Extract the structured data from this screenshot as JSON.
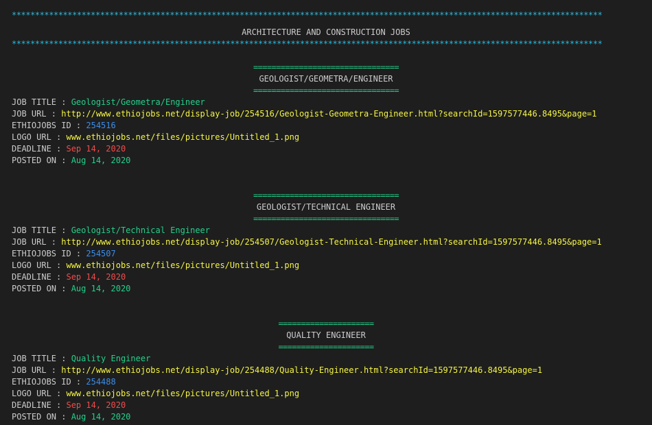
{
  "header": {
    "stars": "*******************************************************************************************************************************",
    "title": "ARCHITECTURE AND CONSTRUCTION JOBS"
  },
  "labels": {
    "job_title": "JOB TITLE : ",
    "job_url": "JOB URL : ",
    "ethiojobs_id": "ETHIOJOBS ID : ",
    "logo_url": "LOGO URL : ",
    "deadline": "DEADLINE : ",
    "posted_on": "POSTED ON : "
  },
  "jobs": [
    {
      "rule": "================================",
      "heading": "GEOLOGIST/GEOMETRA/ENGINEER",
      "job_title": "Geologist/Geometra/Engineer",
      "job_url": "http://www.ethiojobs.net/display-job/254516/Geologist-Geometra-Engineer.html?searchId=1597577446.8495&page=1",
      "ethiojobs_id": "254516",
      "logo_url": "www.ethiojobs.net/files/pictures/Untitled_1.png",
      "deadline": "Sep 14, 2020",
      "posted_on": "Aug 14, 2020"
    },
    {
      "rule": "================================",
      "heading": "GEOLOGIST/TECHNICAL ENGINEER",
      "job_title": "Geologist/Technical Engineer",
      "job_url": "http://www.ethiojobs.net/display-job/254507/Geologist-Technical-Engineer.html?searchId=1597577446.8495&page=1",
      "ethiojobs_id": "254507",
      "logo_url": "www.ethiojobs.net/files/pictures/Untitled_1.png",
      "deadline": "Sep 14, 2020",
      "posted_on": "Aug 14, 2020"
    },
    {
      "rule": "=====================",
      "heading": "QUALITY ENGINEER",
      "job_title": "Quality Engineer",
      "job_url": "http://www.ethiojobs.net/display-job/254488/Quality-Engineer.html?searchId=1597577446.8495&page=1",
      "ethiojobs_id": "254488",
      "logo_url": "www.ethiojobs.net/files/pictures/Untitled_1.png",
      "deadline": "Sep 14, 2020",
      "posted_on": "Aug 14, 2020"
    }
  ],
  "colors": {
    "background": "#1e1e1e",
    "text": "#cccccc",
    "cyan": "#29b8db",
    "green": "#23d18b",
    "yellow": "#f5f543",
    "blue": "#3b8eea",
    "red": "#f14c4c"
  }
}
